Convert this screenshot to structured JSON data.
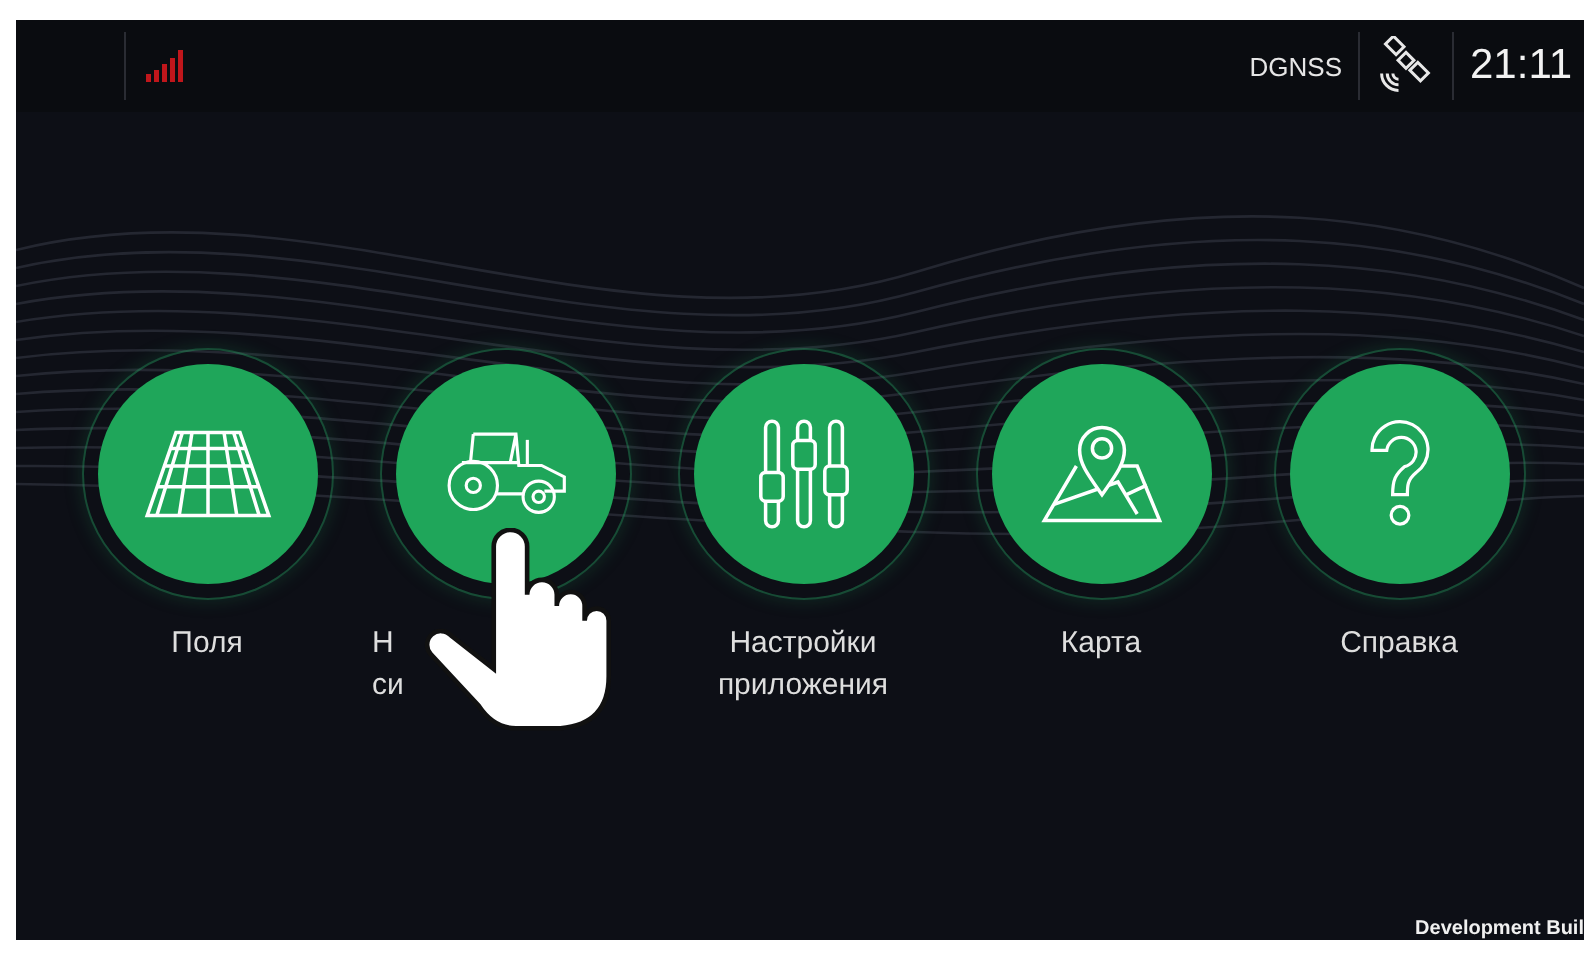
{
  "status_bar": {
    "mode": "DGNSS",
    "time": "21:11"
  },
  "menu": [
    {
      "label": [
        "Поля"
      ],
      "kind": "field",
      "clipped": false
    },
    {
      "label": [
        "Н",
        "си"
      ],
      "kind": "tractor",
      "clipped": true
    },
    {
      "label": [
        "Настройки",
        "приложения"
      ],
      "kind": "sliders",
      "clipped": false
    },
    {
      "label": [
        "Карта"
      ],
      "kind": "map",
      "clipped": false
    },
    {
      "label": [
        "Справка"
      ],
      "kind": "help",
      "clipped": false
    }
  ],
  "build_label": "Development Buil"
}
